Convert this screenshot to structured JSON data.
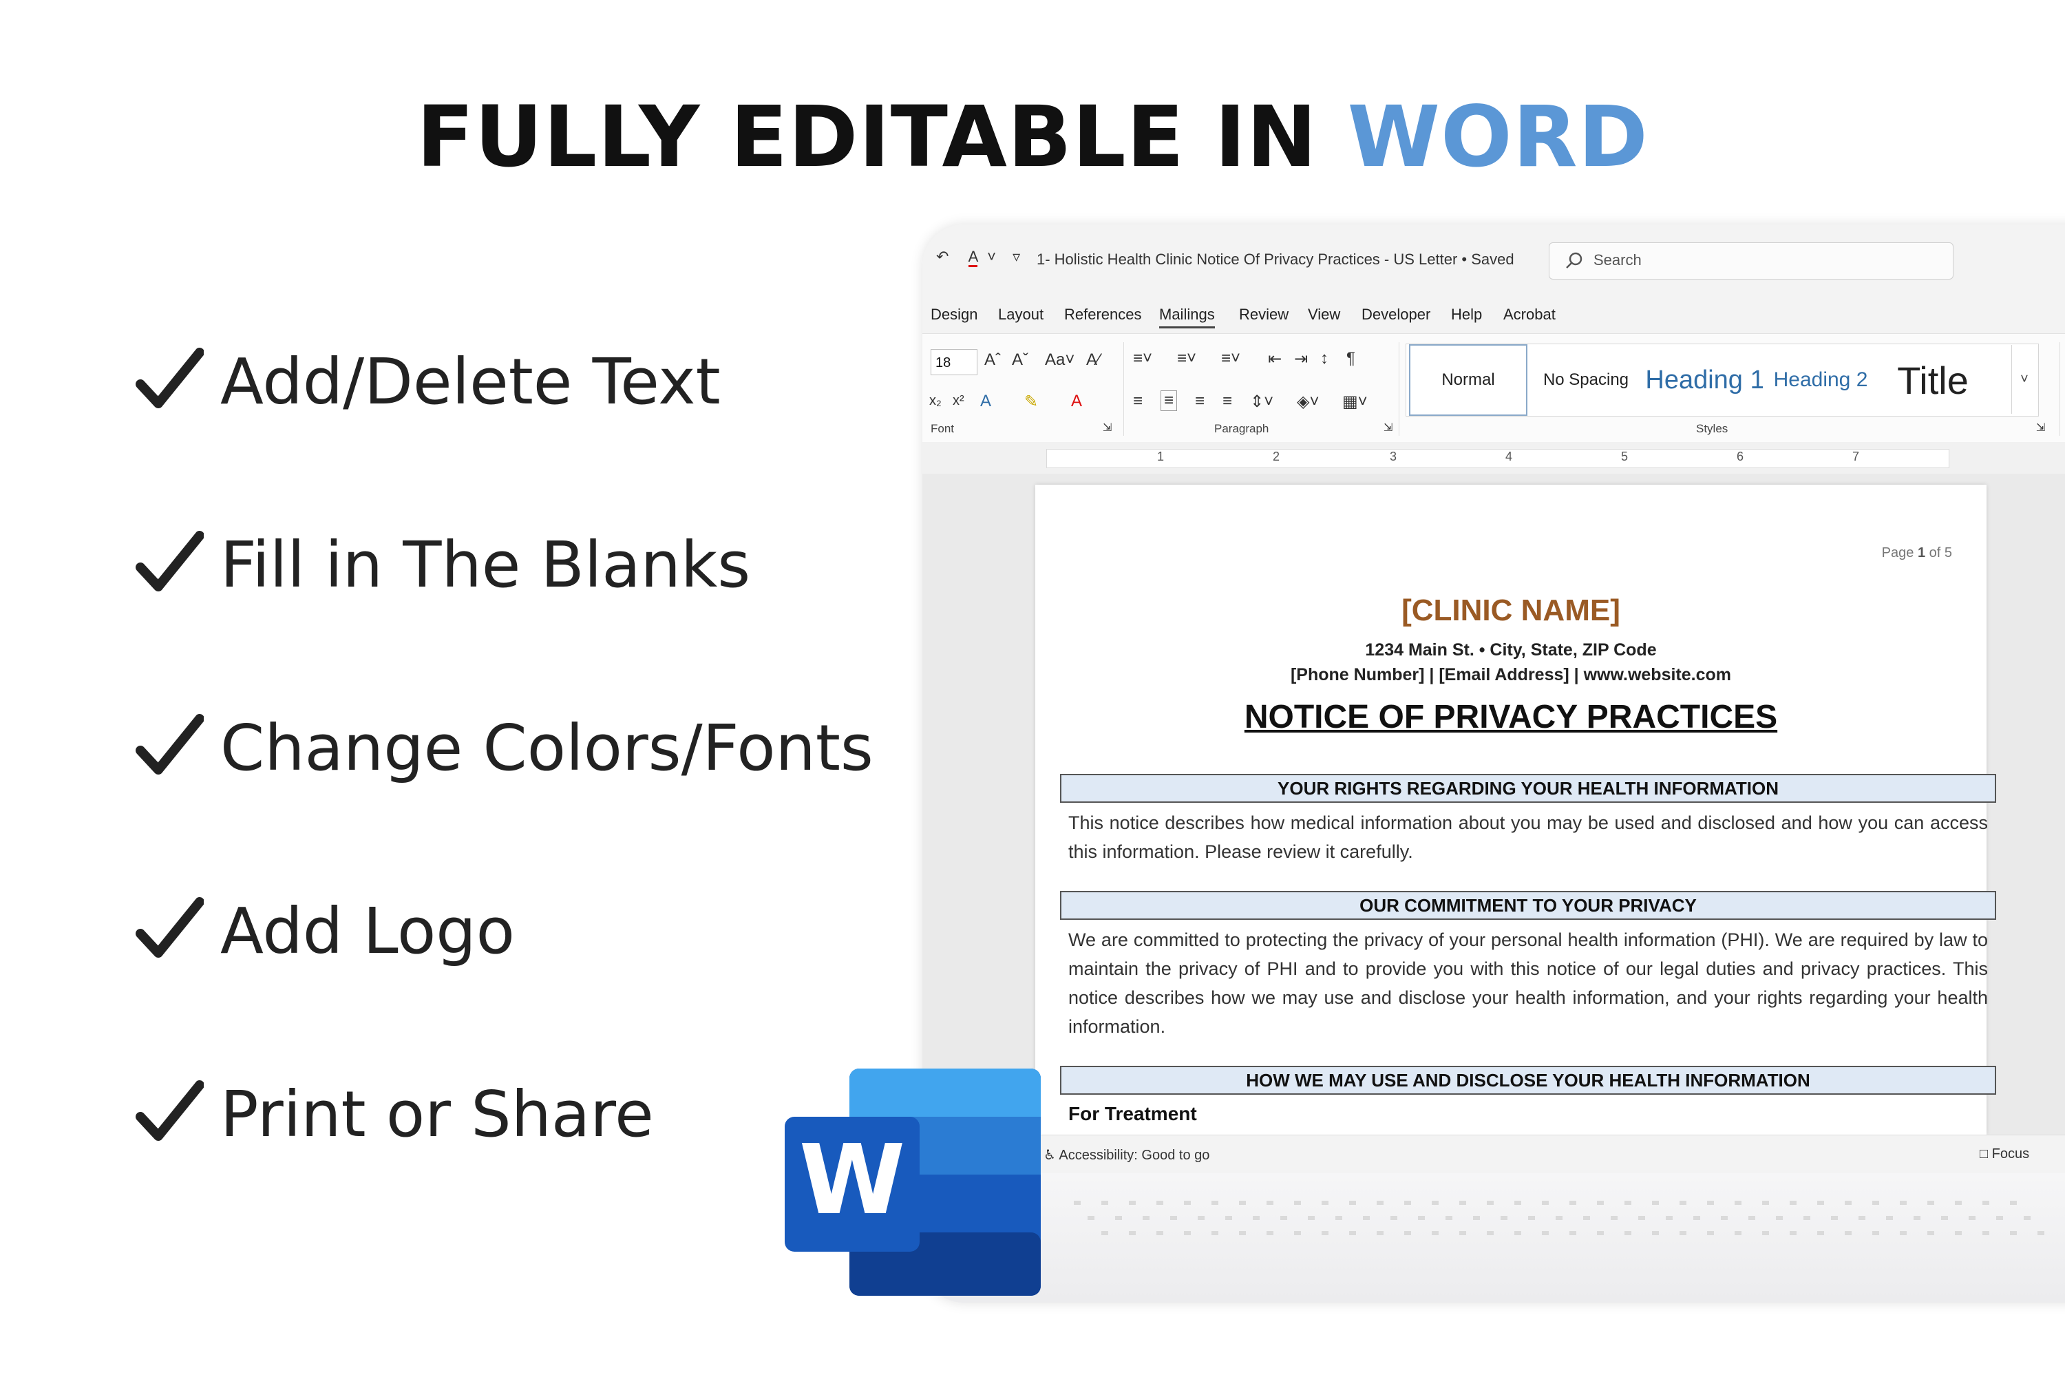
{
  "headline": {
    "main": "FULLY EDITABLE IN ",
    "accent": "WORD"
  },
  "features": [
    {
      "label": "Add/Delete Text"
    },
    {
      "label": "Fill in The Blanks"
    },
    {
      "label": "Change Colors/Fonts"
    },
    {
      "label": "Add Logo"
    },
    {
      "label": "Print or Share"
    }
  ],
  "window": {
    "doc_title": "1- Holistic Health Clinic Notice Of Privacy Practices - US Letter • Saved",
    "search_placeholder": "Search",
    "menu": [
      "Design",
      "Layout",
      "References",
      "Mailings",
      "Review",
      "View",
      "Developer",
      "Help",
      "Acrobat"
    ],
    "font_size": "18",
    "group_labels": {
      "font": "Font",
      "paragraph": "Paragraph",
      "styles": "Styles"
    },
    "styles": {
      "normal": "Normal",
      "no_spacing": "No Spacing",
      "heading1": "Heading 1",
      "heading2": "Heading 2",
      "title": "Title"
    },
    "ruler_numbers": [
      "1",
      "2",
      "3",
      "4",
      "5",
      "6",
      "7"
    ]
  },
  "document": {
    "page_label": "Page",
    "page_current": "1",
    "page_of": "of 5",
    "clinic_name": "[CLINIC NAME]",
    "address": "1234 Main St. • City, State, ZIP Code",
    "contact": "[Phone Number] | [Email Address] | www.website.com",
    "title": "NOTICE OF PRIVACY PRACTICES",
    "section1": "YOUR RIGHTS REGARDING YOUR HEALTH INFORMATION",
    "para1": "This notice describes how medical information about you may be used and disclosed and how you can access this information. Please review it carefully.",
    "section2": "OUR COMMITMENT TO YOUR PRIVACY",
    "para2": "We are committed to protecting the privacy of your personal health information (PHI). We are required by law to maintain the privacy of PHI and to provide you with this notice of our legal duties and privacy practices. This notice describes how we may use and disclose your health information, and your rights regarding your health information.",
    "section3": "HOW WE MAY USE AND DISCLOSE YOUR HEALTH INFORMATION",
    "subhead": "For Treatment"
  },
  "status": {
    "accessibility": "Accessibility: Good to go",
    "focus": "Focus"
  },
  "word_logo_letter": "W",
  "colors": {
    "accent": "#5b97d6",
    "clinic_name": "#9a5a24",
    "section_bar": "#dfe9f5",
    "word_dark": "#185abd"
  }
}
